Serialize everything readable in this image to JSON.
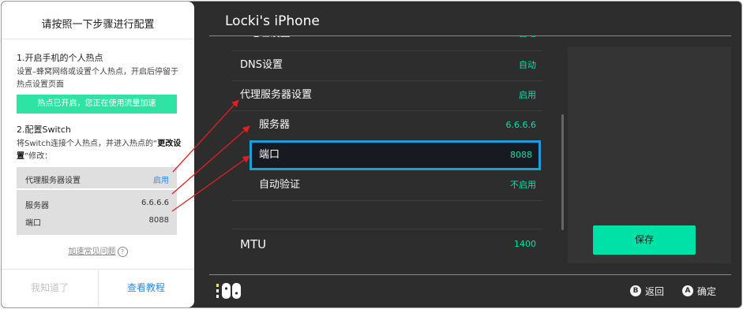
{
  "switch": {
    "title": "Locki's iPhone",
    "rows": {
      "partial": {
        "label": "IP地址设置",
        "value": "自动"
      },
      "dns": {
        "label": "DNS设置",
        "value": "自动"
      },
      "proxy": {
        "label": "代理服务器设置",
        "value": "启用"
      },
      "server": {
        "label": "服务器",
        "value": "6.6.6.6"
      },
      "port": {
        "label": "端口",
        "value": "8088"
      },
      "auth": {
        "label": "自动验证",
        "value": "不启用"
      },
      "mtu": {
        "label": "MTU",
        "value": "1400"
      }
    },
    "save_label": "保存",
    "footer": {
      "back_key": "B",
      "back_label": "返回",
      "confirm_key": "A",
      "confirm_label": "确定"
    }
  },
  "panel": {
    "title": "请按照一下步骤进行配置",
    "step1_heading": "1.开启手机的个人热点",
    "step1_text": "设置–蜂窝网络或设置个人热点，开启后停留于热点设置页面",
    "hotspot_status": "热点已开启，您正在使用流量加速",
    "step2_heading": "2.配置Switch",
    "step2_text_a": "将Switch连接个人热点，并进入热点的“",
    "step2_text_bold": "更改设置",
    "step2_text_b": "”修改：",
    "mock": {
      "proxy_label": "代理服务器设置",
      "proxy_value": "启用",
      "server_label": "服务器",
      "server_value": "6.6.6.6",
      "port_label": "端口",
      "port_value": "8088"
    },
    "faq_label": "加速常见问题",
    "btn_know": "我知道了",
    "btn_tutorial": "查看教程"
  },
  "colors": {
    "accent_green": "#00e3a9",
    "focus_blue": "#1b9fd8",
    "arrow_red": "#e02020",
    "link_blue": "#2a8be0"
  }
}
